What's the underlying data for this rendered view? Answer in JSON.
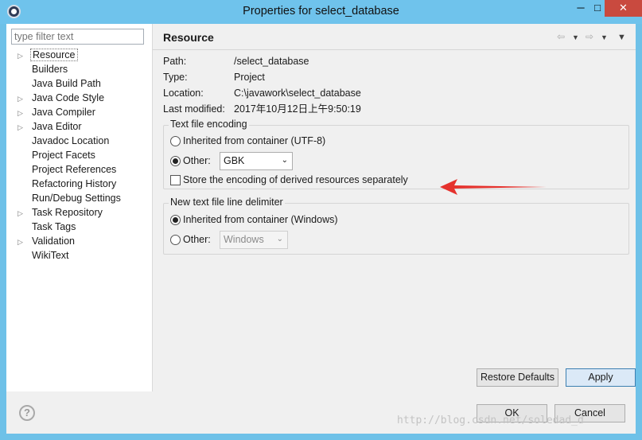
{
  "window": {
    "title": "Properties for select_database",
    "minimize_glyph": "─",
    "maximize_glyph": "□",
    "close_glyph": "✕"
  },
  "nav": {
    "filter_placeholder": "type filter text",
    "items": [
      {
        "label": "Resource",
        "expandable": true,
        "selected": true
      },
      {
        "label": "Builders",
        "expandable": false
      },
      {
        "label": "Java Build Path",
        "expandable": false
      },
      {
        "label": "Java Code Style",
        "expandable": true
      },
      {
        "label": "Java Compiler",
        "expandable": true
      },
      {
        "label": "Java Editor",
        "expandable": true
      },
      {
        "label": "Javadoc Location",
        "expandable": false
      },
      {
        "label": "Project Facets",
        "expandable": false
      },
      {
        "label": "Project References",
        "expandable": false
      },
      {
        "label": "Refactoring History",
        "expandable": false
      },
      {
        "label": "Run/Debug Settings",
        "expandable": false
      },
      {
        "label": "Task Repository",
        "expandable": true
      },
      {
        "label": "Task Tags",
        "expandable": false
      },
      {
        "label": "Validation",
        "expandable": true
      },
      {
        "label": "WikiText",
        "expandable": false
      }
    ]
  },
  "page": {
    "title": "Resource",
    "info": [
      {
        "label": "Path:",
        "value": "/select_database"
      },
      {
        "label": "Type:",
        "value": "Project"
      },
      {
        "label": "Location:",
        "value": "C:\\javawork\\select_database"
      },
      {
        "label": "Last modified:",
        "value": "2017年10月12日上午9:50:19"
      }
    ],
    "encoding": {
      "legend": "Text file encoding",
      "inherited_label": "Inherited from container (UTF-8)",
      "other_label": "Other:",
      "other_value": "GBK",
      "selected": "other",
      "store_label": "Store the encoding of derived resources separately",
      "store_checked": false
    },
    "delimiter": {
      "legend": "New text file line delimiter",
      "inherited_label": "Inherited from container (Windows)",
      "other_label": "Other:",
      "other_value": "Windows",
      "selected": "inherited"
    },
    "restore_label": "Restore Defaults",
    "apply_label": "Apply"
  },
  "footer": {
    "help_glyph": "?",
    "ok_label": "OK",
    "cancel_label": "Cancel",
    "watermark": "http://blog.csdn.net/soledad_d"
  },
  "colors": {
    "titlebar": "#6fc3ec",
    "close_button": "#c94a3f",
    "annotation_arrow": "#e5322d"
  }
}
